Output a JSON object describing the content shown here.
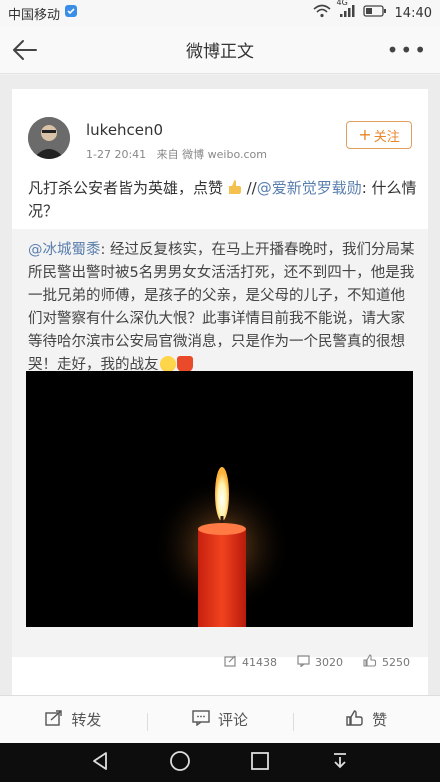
{
  "status_bar": {
    "carrier": "中国移动",
    "network": "4G",
    "time": "14:40"
  },
  "nav": {
    "title": "微博正文"
  },
  "post": {
    "username": "lukehcen0",
    "time": "1-27 20:41",
    "source_prefix": "来自",
    "source": "微博 weibo.com",
    "follow_label": "关注",
    "text_main": "凡打杀公安者皆为英雄，点赞",
    "text_sep": "//",
    "text_mention": "@爱新觉罗载勋",
    "text_tail": ": 什么情况？"
  },
  "repost": {
    "mention": "@冰城蜀黍",
    "text": ": 经过反复核实，在马上开播春晚时，我们分局某所民警出警时被5名男男女女活活打死，还不到四十，他是我一批兄弟的师傅，是孩子的父亲，是父母的儿子，不知道他们对警察有什么深仇大恨？此事详情目前我不能说，请大家等待哈尔滨市公安局官微消息，只是作为一个民警真的很想哭！走好，我的战友",
    "stats": {
      "reposts": "41438",
      "comments": "3020",
      "likes": "5250"
    }
  },
  "actions": {
    "repost": "转发",
    "comment": "评论",
    "like": "赞"
  }
}
